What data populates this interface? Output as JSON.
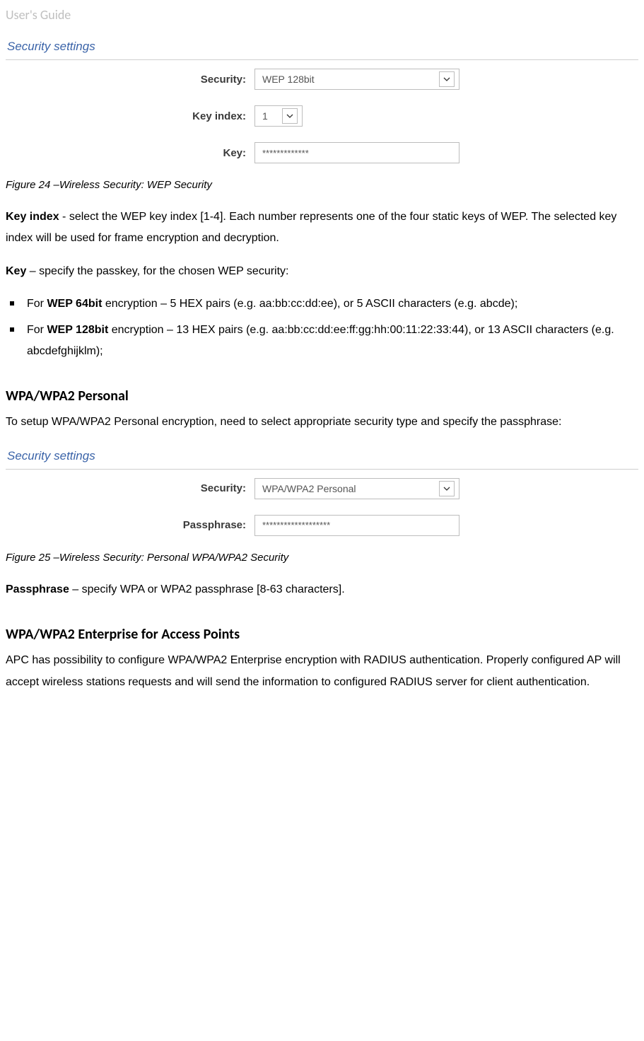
{
  "header": "User's Guide",
  "panel1": {
    "title": "Security settings",
    "rows": {
      "security": {
        "label": "Security:",
        "value": "WEP 128bit"
      },
      "keyindex": {
        "label": "Key index:",
        "value": "1"
      },
      "key": {
        "label": "Key:",
        "value": "*************"
      }
    }
  },
  "caption1": "Figure 24 –Wireless Security: WEP Security",
  "para_keyindex_strong": "Key index",
  "para_keyindex_rest": " - select the WEP key index [1-4]. Each number represents one of the four static keys of WEP. The selected key index will be used for frame encryption and decryption.",
  "para_key_strong": "Key",
  "para_key_rest": " – specify the passkey, for the chosen WEP security:",
  "bullets": {
    "b1_pre": "For ",
    "b1_strong": "WEP 64bit",
    "b1_post": " encryption – 5 HEX pairs (e.g. aa:bb:cc:dd:ee), or 5 ASCII characters (e.g. abcde);",
    "b2_pre": "For ",
    "b2_strong": "WEP 128bit",
    "b2_post": " encryption – 13 HEX pairs (e.g. aa:bb:cc:dd:ee:ff:gg:hh:00:11:22:33:44), or 13 ASCII characters (e.g. abcdefghijklm);"
  },
  "section_wpa_personal": {
    "title": "WPA/WPA2 Personal",
    "intro": "To setup WPA/WPA2 Personal encryption, need to select appropriate security type and specify the passphrase:"
  },
  "panel2": {
    "title": "Security settings",
    "rows": {
      "security": {
        "label": "Security:",
        "value": "WPA/WPA2 Personal"
      },
      "passphrase": {
        "label": "Passphrase:",
        "value": "*******************"
      }
    }
  },
  "caption2": "Figure 25 –Wireless Security: Personal WPA/WPA2 Security",
  "para_passphrase_strong": "Passphrase",
  "para_passphrase_rest": " – specify WPA or WPA2 passphrase [8-63 characters].",
  "section_wpa_enterprise": {
    "title": "WPA/WPA2 Enterprise for Access Points",
    "intro": "APC has possibility to configure WPA/WPA2 Enterprise encryption with RADIUS authentication. Properly configured AP will accept wireless stations requests and will send the information to configured RADIUS server for client authentication."
  }
}
